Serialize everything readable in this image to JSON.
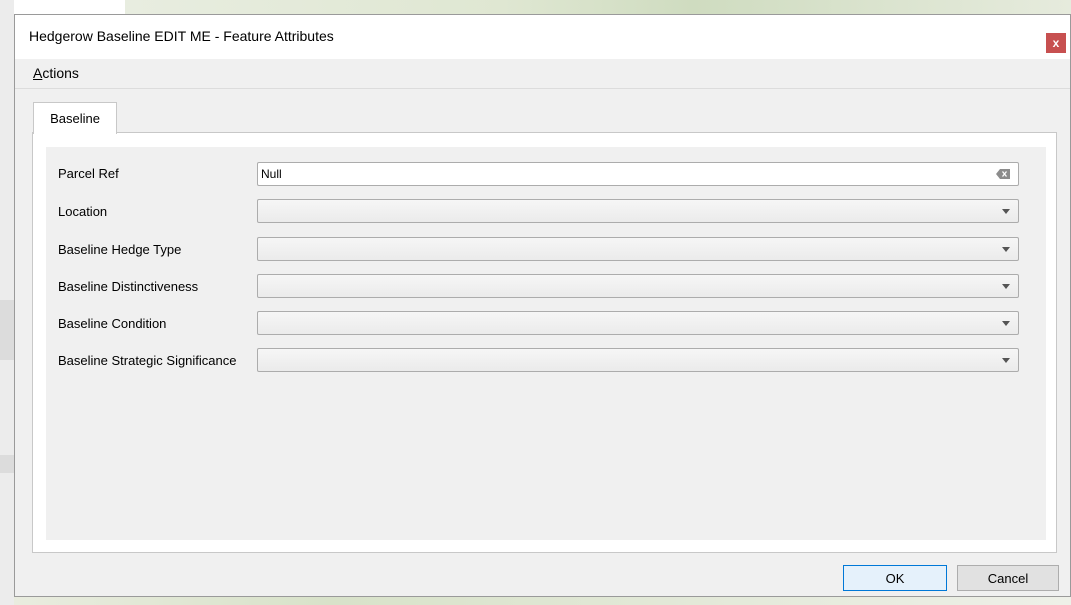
{
  "window": {
    "title": "Hedgerow Baseline EDIT ME - Feature Attributes",
    "close_label": "x"
  },
  "menu": {
    "actions_first": "A",
    "actions_rest": "ctions"
  },
  "tabs": [
    {
      "label": "Baseline",
      "active": true
    }
  ],
  "fields": [
    {
      "label": "Parcel Ref",
      "value": "Null",
      "kind": "text"
    },
    {
      "label": "Location",
      "value": "",
      "kind": "combo"
    },
    {
      "label": "Baseline Hedge Type",
      "value": "",
      "kind": "combo"
    },
    {
      "label": "Baseline Distinctiveness",
      "value": "",
      "kind": "combo"
    },
    {
      "label": "Baseline Condition",
      "value": "",
      "kind": "combo"
    },
    {
      "label": "Baseline Strategic Significance",
      "value": "",
      "kind": "combo"
    }
  ],
  "buttons": {
    "ok": "OK",
    "cancel": "Cancel"
  },
  "colors": {
    "close_button": "#c75050",
    "dialog_bg": "#f0f0f0",
    "ok_border": "#0078d7"
  }
}
